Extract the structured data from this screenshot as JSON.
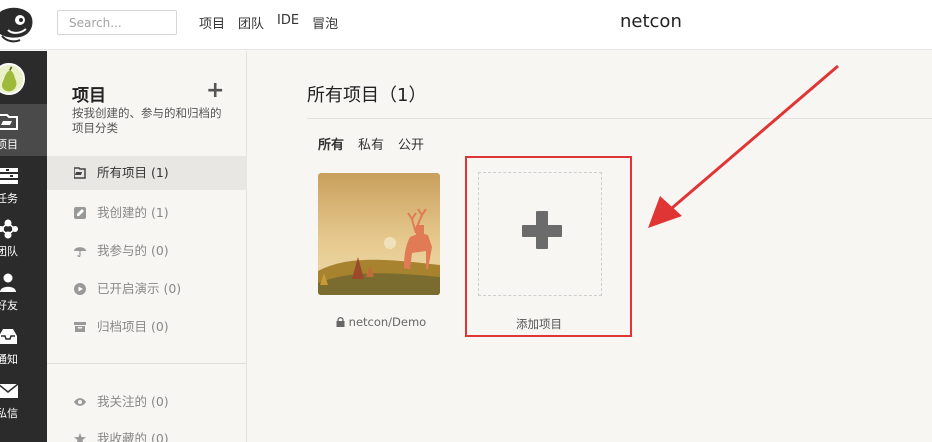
{
  "topbar": {
    "search_placeholder": "Search...",
    "nav": [
      "项目",
      "团队",
      "IDE",
      "冒泡"
    ],
    "title": "netcon"
  },
  "rail": {
    "items": [
      {
        "label": "项目",
        "icon": "folder-icon",
        "active": true
      },
      {
        "label": "任务",
        "icon": "tasks-icon"
      },
      {
        "label": "团队",
        "icon": "team-icon"
      },
      {
        "label": "好友",
        "icon": "friend-icon"
      },
      {
        "label": "通知",
        "icon": "inbox-icon"
      },
      {
        "label": "私信",
        "icon": "mail-icon"
      }
    ]
  },
  "sidebar": {
    "title": "项目",
    "add_symbol": "+",
    "description": "按我创建的、参与的和归档的项目分类",
    "items": [
      {
        "label": "所有项目 (1)",
        "icon": "folder-icon",
        "active": true
      },
      {
        "label": "我创建的 (1)",
        "icon": "edit-icon"
      },
      {
        "label": "我参与的 (0)",
        "icon": "umbrella-icon"
      },
      {
        "label": "已开启演示 (0)",
        "icon": "play-icon"
      },
      {
        "label": "归档项目 (0)",
        "icon": "archive-icon"
      },
      {
        "label": "我关注的 (0)",
        "icon": "eye-icon"
      },
      {
        "label": "我收藏的 (0)",
        "icon": "star-icon"
      }
    ]
  },
  "main": {
    "title": "所有项目（1）",
    "filters": [
      {
        "label": "所有",
        "active": true
      },
      {
        "label": "私有"
      },
      {
        "label": "公开"
      }
    ],
    "project": {
      "name": "netcon/Demo",
      "lock_icon": "lock-icon"
    },
    "add_project_label": "添加项目"
  },
  "colors": {
    "highlight_red": "#e03535",
    "rail_bg": "#2b2b2b",
    "page_bg": "#f7f6f3"
  }
}
